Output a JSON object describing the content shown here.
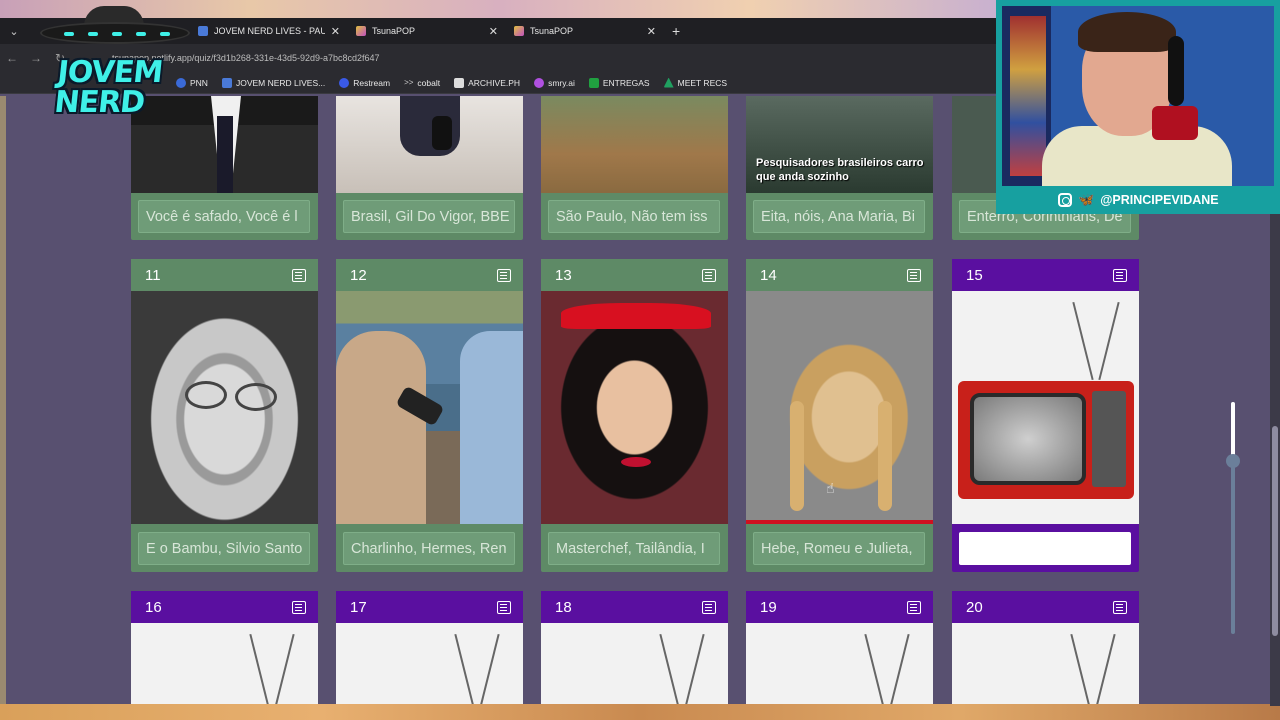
{
  "browser": {
    "tabs": [
      {
        "title": "JOVEM NERD LIVES - PAUTA - (",
        "color": "#4a7ad8"
      },
      {
        "title": "TsunaPOP",
        "color": "#e0c040"
      },
      {
        "title": "TsunaPOP",
        "color": "#e0c040"
      }
    ],
    "url": "tsunapop.netlify.app/quiz/f3d1b268-331e-43d5-92d9-a7bc8cd2f647",
    "bookmarks": [
      {
        "label": "PNN",
        "color": "#3a6ad8"
      },
      {
        "label": "JOVEM NERD LIVES...",
        "color": "#4a7ad8"
      },
      {
        "label": "Restream",
        "color": "#3a5ae8"
      },
      {
        "label": "cobalt",
        "color": "#888888"
      },
      {
        "label": "ARCHIVE.PH",
        "color": "#dddddd"
      },
      {
        "label": "smry.ai",
        "color": "#b050e0"
      },
      {
        "label": "ENTREGAS",
        "color": "#20a040"
      },
      {
        "label": "MEET RECS",
        "color": "#20a060"
      }
    ]
  },
  "logo": {
    "text": "JOVEM NERD"
  },
  "cards_top_row": [
    {
      "answer": "Você é safado, Você é l"
    },
    {
      "answer": "Brasil, Gil Do Vigor, BBE"
    },
    {
      "answer": "São Paulo, Não tem iss"
    },
    {
      "answer": "Eita, nóis, Ana Maria, Bi"
    },
    {
      "answer": "Enterro, Corinthians, De"
    }
  ],
  "cards_mid_row": [
    {
      "number": "11",
      "answer": "E o Bambu, Silvio Santo",
      "state": "answered"
    },
    {
      "number": "12",
      "answer": "Charlinho, Hermes, Ren",
      "state": "answered"
    },
    {
      "number": "13",
      "answer": "Masterchef, Tailândia, I",
      "state": "answered"
    },
    {
      "number": "14",
      "answer": "Hebe, Romeu e Julieta,",
      "state": "answered"
    },
    {
      "number": "15",
      "answer": "",
      "state": "active"
    }
  ],
  "cards_bottom_row": [
    {
      "number": "16"
    },
    {
      "number": "17"
    },
    {
      "number": "18"
    },
    {
      "number": "19"
    },
    {
      "number": "20"
    }
  ],
  "card_top_caption": "Pesquisadores brasileiros carro que anda sozinho",
  "webcam": {
    "handle": "@PRINCIPEVIDANE"
  },
  "colors": {
    "answered": "#5e8a66",
    "active": "#5a0fa0",
    "page_bg": "#585070"
  }
}
